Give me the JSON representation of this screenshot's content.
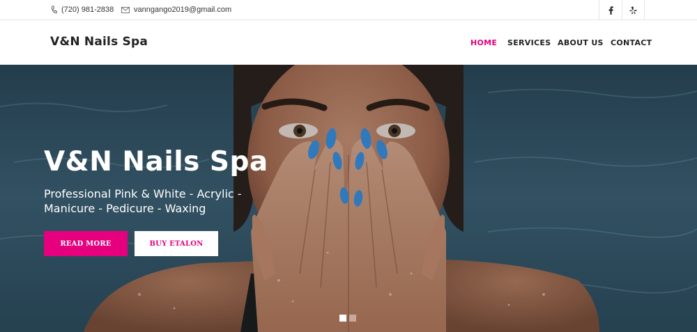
{
  "topbar": {
    "phone": "(720) 981-2838",
    "email": "vanngango2019@gmail.com",
    "social": [
      {
        "icon": "facebook-icon",
        "glyph": "f"
      },
      {
        "icon": "yelp-icon",
        "glyph": "✱"
      }
    ]
  },
  "header": {
    "logo": "V&N Nails Spa",
    "nav": [
      {
        "label": "HOME",
        "active": true
      },
      {
        "label": "SERVICES",
        "active": false
      },
      {
        "label": "ABOUT US",
        "active": false
      },
      {
        "label": "CONTACT",
        "active": false
      }
    ]
  },
  "hero": {
    "title": "V&N Nails Spa",
    "subtitle": "Professional Pink & White - Acrylic - Manicure - Pedicure - Waxing",
    "primary_button": "READ MORE",
    "secondary_button": "BUY ETALON",
    "slides": [
      {
        "active": true
      },
      {
        "active": false
      }
    ]
  },
  "colors": {
    "accent": "#e6007e",
    "text": "#222222"
  }
}
